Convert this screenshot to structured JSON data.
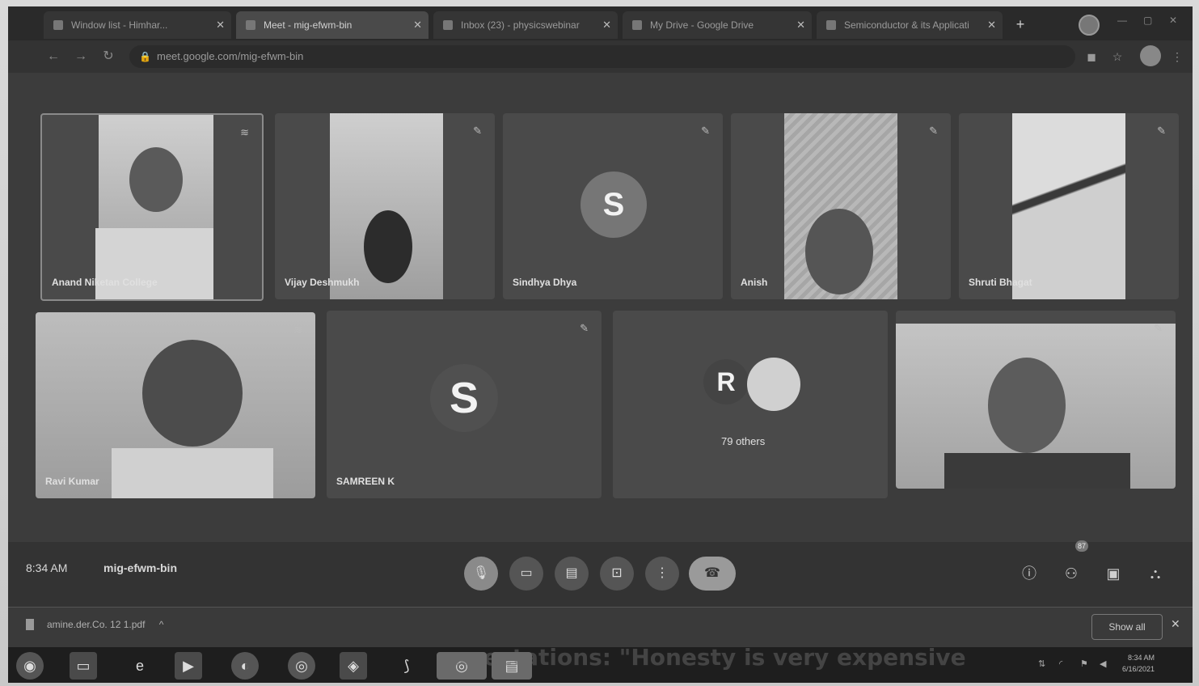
{
  "browser": {
    "tabs": [
      {
        "label": "Window list - Himhar..."
      },
      {
        "label": "Meet - mig-efwm-bin"
      },
      {
        "label": "Inbox (23) - physicswebinar"
      },
      {
        "label": "My Drive - Google Drive"
      },
      {
        "label": "Semiconductor & its Applicati"
      }
    ],
    "url": "meet.google.com/mig-efwm-bin",
    "new_tab": "+"
  },
  "meet": {
    "participants": [
      {
        "name": "Anand Niketan College"
      },
      {
        "name": "Vijay Deshmukh"
      },
      {
        "name": "Sindhya Dhya",
        "initial": "S"
      },
      {
        "name": "Anish"
      },
      {
        "name": "Shruti Bhagat"
      },
      {
        "name": "Ravi Kumar"
      },
      {
        "name": "SAMREEN K",
        "initial": "S"
      },
      {
        "name": "",
        "initial": "R",
        "others": "79 others"
      },
      {
        "name": ""
      }
    ],
    "time": "8:34 AM",
    "meeting_code": "mig-efwm-bin",
    "people_badge": "87"
  },
  "downloads": {
    "file": "amine.der.Co. 12 1.pdf",
    "show_all": "Show all"
  },
  "taskbar": {
    "clock_time": "8:34 AM",
    "clock_date": "6/16/2021",
    "overlay": "xpectations: \"Honesty is very expensive"
  }
}
